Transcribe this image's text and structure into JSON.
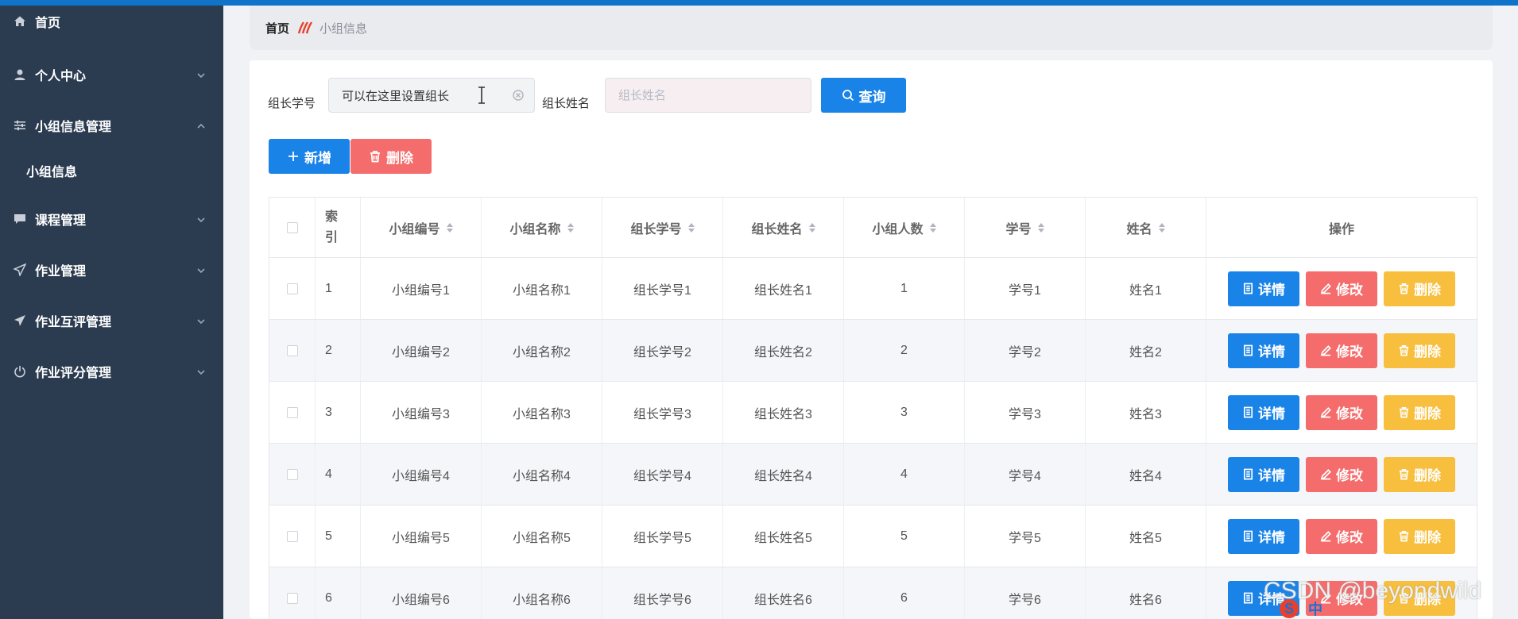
{
  "sidebar": {
    "items": [
      {
        "label": "首页",
        "icon": "home-icon"
      },
      {
        "label": "个人中心",
        "icon": "user-icon"
      },
      {
        "label": "小组信息管理",
        "icon": "sliders-icon"
      },
      {
        "label": "课程管理",
        "icon": "chat-icon"
      },
      {
        "label": "作业管理",
        "icon": "send-icon"
      },
      {
        "label": "作业互评管理",
        "icon": "send-filled-icon"
      },
      {
        "label": "作业评分管理",
        "icon": "power-icon"
      }
    ],
    "sub_item": "小组信息"
  },
  "breadcrumb": {
    "home": "首页",
    "current": "小组信息"
  },
  "search": {
    "leader_no_label": "组长学号",
    "leader_no_value": "可以在这里设置组长",
    "leader_name_label": "组长姓名",
    "leader_name_placeholder": "组长姓名",
    "query_button": "查询"
  },
  "actions": {
    "add": "新增",
    "delete": "删除"
  },
  "table": {
    "headers": [
      "索引",
      "小组编号",
      "小组名称",
      "组长学号",
      "组长姓名",
      "小组人数",
      "学号",
      "姓名",
      "操作"
    ],
    "rows": [
      [
        "1",
        "小组编号1",
        "小组名称1",
        "组长学号1",
        "组长姓名1",
        "1",
        "学号1",
        "姓名1"
      ],
      [
        "2",
        "小组编号2",
        "小组名称2",
        "组长学号2",
        "组长姓名2",
        "2",
        "学号2",
        "姓名2"
      ],
      [
        "3",
        "小组编号3",
        "小组名称3",
        "组长学号3",
        "组长姓名3",
        "3",
        "学号3",
        "姓名3"
      ],
      [
        "4",
        "小组编号4",
        "小组名称4",
        "组长学号4",
        "组长姓名4",
        "4",
        "学号4",
        "姓名4"
      ],
      [
        "5",
        "小组编号5",
        "小组名称5",
        "组长学号5",
        "组长姓名5",
        "5",
        "学号5",
        "姓名5"
      ],
      [
        "6",
        "小组编号6",
        "小组名称6",
        "组长学号6",
        "组长姓名6",
        "6",
        "学号6",
        "姓名6"
      ]
    ],
    "op_labels": {
      "detail": "详情",
      "edit": "修改",
      "delete": "删除"
    }
  },
  "watermark": "CSDN @beyondwild",
  "ime": {
    "logo": "S",
    "lang": "中"
  },
  "colors": {
    "primary": "#1a83e8",
    "danger": "#f56c6c",
    "warning": "#f7bf3d",
    "sidebar": "#2b3b50",
    "topbar": "#0f73c9"
  }
}
